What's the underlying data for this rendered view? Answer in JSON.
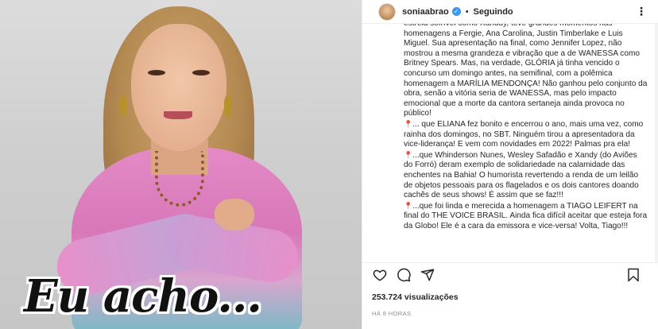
{
  "image": {
    "overlay_text": "Eu acho..."
  },
  "header": {
    "username": "soniaabrao",
    "separator": "•",
    "follow_status": "Seguindo",
    "more_label": "⋮",
    "verified_glyph": "✓"
  },
  "caption": {
    "paragraphs": [
      "estreia sofrível como Xanddy, teve grandes momentos nas homenagens a Fergie, Ana Carolina, Justin Timberlake e Luis Miguel. Sua apresentação na final, como Jennifer Lopez, não mostrou a mesma grandeza e vibração que a de WANESSA como Britney Spears. Mas, na verdade, GLÓRIA já tinha vencido o concurso um domingo antes, na semifinal, com a polêmica homenagem a MARÍLIA MENDONÇA! Não ganhou pelo conjunto da obra, senão a vitória seria de WANESSA, mas pelo impacto emocional que a morte da cantora sertaneja ainda provoca no público!",
      "... que ELIANA fez bonito e encerrou o ano, mais uma vez, como rainha dos domingos, no SBT. Ninguém tirou a apresentadora da vice-liderança! E vem com novidades em 2022! Palmas pra ela!",
      "...que Whinderson Nunes, Wesley Safadão e Xandy (do Aviões do Forró) deram exemplo de solidariedade na calamidade das enchentes na Bahia! O humorista revertendo a renda de um leilão de objetos pessoais para os flagelados e os dois cantores doando cachês de seus shows! É assim que se faz!!!",
      "...que foi linda e merecida a homenagem a TIAGO LEIFERT na final do THE VOICE BRASIL. Ainda fica difícil aceitar que esteja fora da Globo! Ele é a cara da emissora e vice-versa! Volta, Tiago!!!"
    ],
    "pin_glyph": "📍"
  },
  "actions": {
    "like_icon": "heart-icon",
    "comment_icon": "comment-icon",
    "share_icon": "share-icon",
    "save_icon": "bookmark-icon"
  },
  "stats": {
    "views": "253.724 visualizações",
    "time": "HÁ 8 HORAS"
  }
}
